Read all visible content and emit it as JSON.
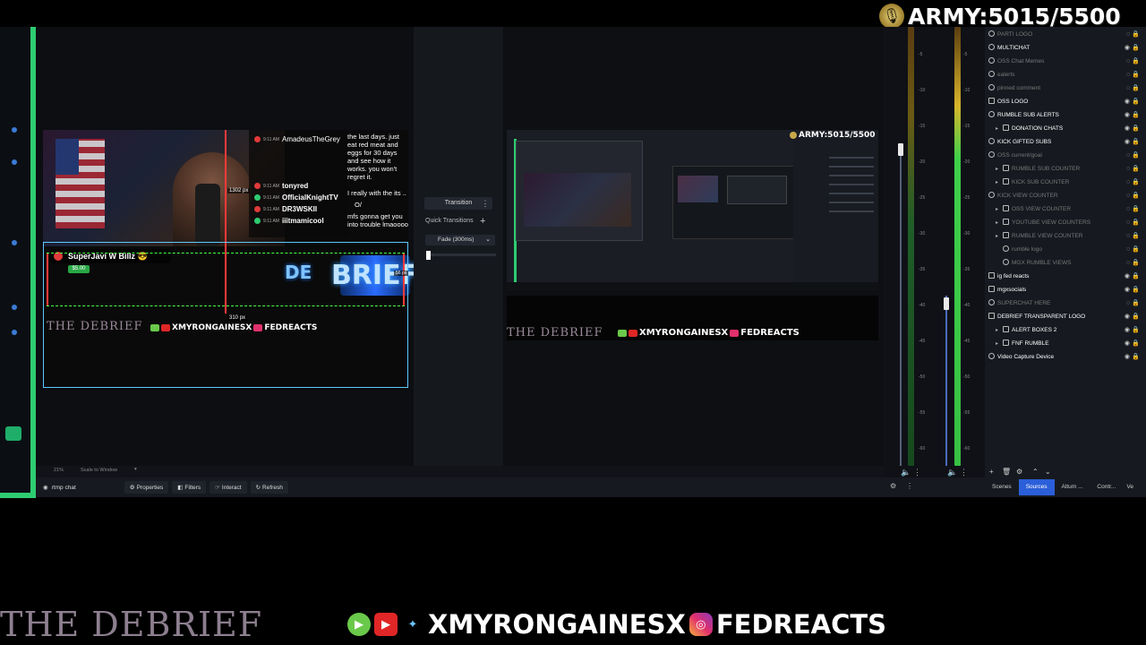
{
  "banner": {
    "army_text": "ARMY:5015/5500",
    "mic_icon": "mic-icon"
  },
  "preview": {
    "chat_messages": [
      {
        "user": "AmadeusTheGrey",
        "time": "9:11 AM"
      },
      {
        "user": "tonyred",
        "time": "9:11 AM"
      },
      {
        "user": "OfficialKnightTV",
        "time": "9:11 AM"
      },
      {
        "user": "DR3WSKII",
        "time": "9:11 AM"
      },
      {
        "user": "iiitmamicool",
        "time": "9:11 AM"
      }
    ],
    "message_text": [
      "the last days. just eat red meat and eggs for 30 days and see how it works. you won't regret it.",
      "I really with the its ..",
      "O/",
      "mfs gonna get you into trouble lmaoooo"
    ],
    "superchat_user": "SuperJavi W Billz 😎",
    "superchat_amount": "$5.00",
    "width_label": "1302 px",
    "height_label": "310 px",
    "side_label": "56 px",
    "neon_text": "DE",
    "neon_text2": "BRIEF",
    "debrief_small": "THE DEBRIEF",
    "social_small": "XMYRONGAINESX",
    "social_small2": "FEDREACTS"
  },
  "transitions": {
    "transition_label": "Transition",
    "quick_label": "Quick Transitions",
    "fade_label": "Fade (300ms)",
    "slider_value": 0
  },
  "program": {
    "army_small": "ARMY:5015/5500",
    "debrief_mid": "THE DEBRIEF",
    "social_mid": "XMYRONGAINESX",
    "social_mid2": "FEDREACTS"
  },
  "mixer": {
    "scale": [
      "-5",
      "-10",
      "-15",
      "-20",
      "-25",
      "-30",
      "-35",
      "-40",
      "-45",
      "-50",
      "-55",
      "-60"
    ],
    "channel1_level": 0.42,
    "channel2_level": 0.75
  },
  "sources": [
    {
      "label": "PARTI LOGO",
      "dim": true,
      "indent": 0,
      "type": "src"
    },
    {
      "label": "MULTICHAT",
      "dim": false,
      "indent": 0,
      "type": "src"
    },
    {
      "label": "OSS Chat Memes",
      "dim": true,
      "indent": 0,
      "type": "src"
    },
    {
      "label": "ealerts",
      "dim": true,
      "indent": 0,
      "type": "src"
    },
    {
      "label": "pinned comment",
      "dim": true,
      "indent": 0,
      "type": "src"
    },
    {
      "label": "OSS LOGO",
      "dim": false,
      "indent": 0,
      "type": "img"
    },
    {
      "label": "RUMBLE SUB ALERTS",
      "dim": false,
      "indent": 0,
      "type": "src"
    },
    {
      "label": "DONATION CHATS",
      "dim": false,
      "indent": 1,
      "type": "fold"
    },
    {
      "label": "KICK GIFTED SUBS",
      "dim": false,
      "indent": 0,
      "type": "src"
    },
    {
      "label": "OSS current/goal",
      "dim": true,
      "indent": 0,
      "type": "src"
    },
    {
      "label": "RUMBLE SUB COUNTER",
      "dim": true,
      "indent": 1,
      "type": "fold"
    },
    {
      "label": "KICK SUB COUNTER",
      "dim": true,
      "indent": 1,
      "type": "fold"
    },
    {
      "label": "KICK VIEW COUNTER",
      "dim": true,
      "indent": 0,
      "type": "src"
    },
    {
      "label": "OSS VIEW COUNTER",
      "dim": true,
      "indent": 1,
      "type": "fold"
    },
    {
      "label": "YOUTUBE VIEW COUNTERS",
      "dim": true,
      "indent": 1,
      "type": "fold"
    },
    {
      "label": "RUMBLE VIEW COUNTER",
      "dim": true,
      "indent": 1,
      "type": "fold"
    },
    {
      "label": "rumble logo",
      "dim": true,
      "indent": 2,
      "type": "src"
    },
    {
      "label": "MGX RUMBLE VIEWS",
      "dim": true,
      "indent": 2,
      "type": "src"
    },
    {
      "label": "ig fed reacts",
      "dim": false,
      "indent": 0,
      "type": "img"
    },
    {
      "label": "mgxsocials",
      "dim": false,
      "indent": 0,
      "type": "img"
    },
    {
      "label": "SUPERCHAT HERE",
      "dim": true,
      "indent": 0,
      "type": "src"
    },
    {
      "label": "DEBRIEF TRANSPARENT LOGO",
      "dim": false,
      "indent": 0,
      "type": "img"
    },
    {
      "label": "ALERT BOXES 2",
      "dim": false,
      "indent": 1,
      "type": "fold"
    },
    {
      "label": "FNF RUMBLE",
      "dim": false,
      "indent": 1,
      "type": "fold"
    },
    {
      "label": "Video Capture Device",
      "dim": false,
      "indent": 0,
      "type": "src"
    }
  ],
  "tabs": [
    {
      "label": "Scenes",
      "active": false
    },
    {
      "label": "Sources",
      "active": true
    },
    {
      "label": "Altum ...",
      "active": false
    },
    {
      "label": "Contr...",
      "active": false
    },
    {
      "label": "Ve",
      "active": false
    }
  ],
  "toolbar": {
    "source_name": "rtmp chat",
    "properties": "Properties",
    "filters": "Filters",
    "interact": "Interact",
    "refresh": "Refresh",
    "zoom": "21%",
    "scale": "Scale to Window"
  },
  "overlay": {
    "debrief": "THE DEBRIEF",
    "social_handle": "XMYRONGAINESX",
    "social_handle2": "FEDREACTS"
  },
  "colors": {
    "accent_green": "#2ecc71",
    "selection": "#5ec8ff",
    "active_tab": "#2b5fd9"
  }
}
